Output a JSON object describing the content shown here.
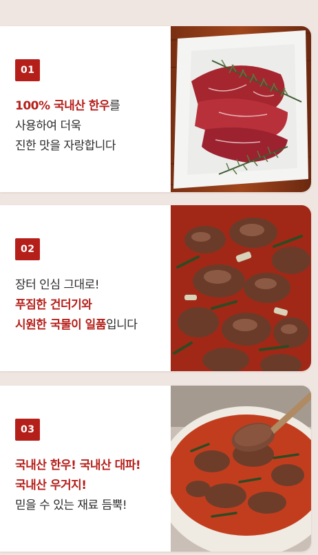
{
  "items": [
    {
      "badge": "01",
      "lines": [
        {
          "hl": "100% 국내산 한우",
          "rest": "를"
        },
        {
          "hl": "",
          "rest": "사용하여 더욱"
        },
        {
          "hl": "",
          "rest": "진한 맛을 자랑합니다"
        }
      ],
      "photo_icon": "raw-beef-with-rosemary"
    },
    {
      "badge": "02",
      "lines": [
        {
          "hl": "",
          "rest": "장터 인심 그대로!"
        },
        {
          "hl": "푸짐한 건더기와",
          "rest": ""
        },
        {
          "hl": "시원한 국물이 일품",
          "rest": "입니다"
        }
      ],
      "photo_icon": "beef-stew-closeup"
    },
    {
      "badge": "03",
      "lines": [
        {
          "hl": "국내산 한우! 국내산 대파!",
          "rest": ""
        },
        {
          "hl": "국내산 우거지!",
          "rest": ""
        },
        {
          "hl": "",
          "rest": "믿을 수 있는 재료 듬뿍!"
        }
      ],
      "photo_icon": "stew-bowl-with-spoon"
    }
  ],
  "colors": {
    "accent": "#b51f1a",
    "background": "#efe6e2",
    "text": "#2b2b2b"
  }
}
